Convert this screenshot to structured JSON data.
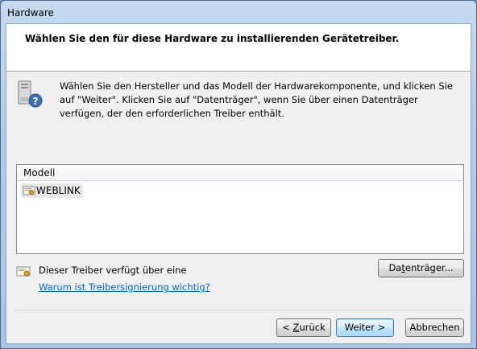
{
  "window": {
    "title": "Hardware"
  },
  "header": {
    "title": "Wählen Sie den für diese Hardware zu installierenden Gerätetreiber."
  },
  "info": {
    "text": "Wählen Sie den Hersteller und das Modell der Hardwarekomponente, und klicken Sie auf \"Weiter\". Klicken Sie auf \"Datenträger\", wenn Sie über einen Datenträger verfügen, der den erforderlichen Treiber enthält."
  },
  "model_list": {
    "header": "Modell",
    "items": [
      {
        "label": "WEBLINK",
        "selected": true
      }
    ]
  },
  "signature": {
    "text": "Dieser Treiber verfügt über eine",
    "link": "Warum ist Treibersignierung wichtig?"
  },
  "buttons": {
    "disk": {
      "pre": "Da",
      "mnemonic": "t",
      "post": "enträger..."
    },
    "back": {
      "pre": "< ",
      "mnemonic": "Z",
      "post": "urück"
    },
    "next": {
      "label": "Weiter >"
    },
    "cancel": {
      "label": "Abbrechen"
    }
  }
}
